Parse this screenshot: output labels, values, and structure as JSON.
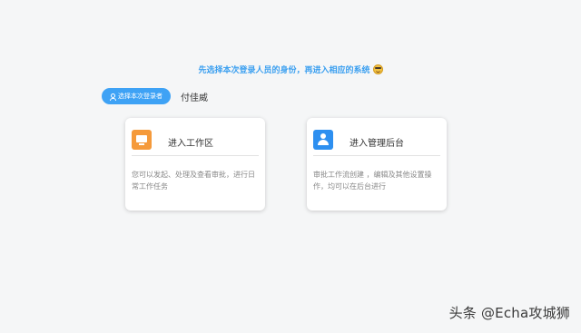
{
  "header": {
    "prompt": "先选择本次登录人员的身份，再进入相应的系统"
  },
  "user": {
    "select_button_label": "选择本次登录者",
    "selected_name": "付佳威"
  },
  "cards": [
    {
      "title": "进入工作区",
      "description": "您可以发起、处理及查看审批，进行日常工作任务",
      "icon": "monitor-icon",
      "color": "#f59a3b"
    },
    {
      "title": "进入管理后台",
      "description": "审批工作流创建 ，编辑及其他设置操作，均可以在后台进行",
      "icon": "person-icon",
      "color": "#2d8ff0"
    }
  ],
  "colors": {
    "accent": "#3ea2f5",
    "background": "#f5f6f7"
  },
  "watermark": "头条 @Echa攻城狮"
}
